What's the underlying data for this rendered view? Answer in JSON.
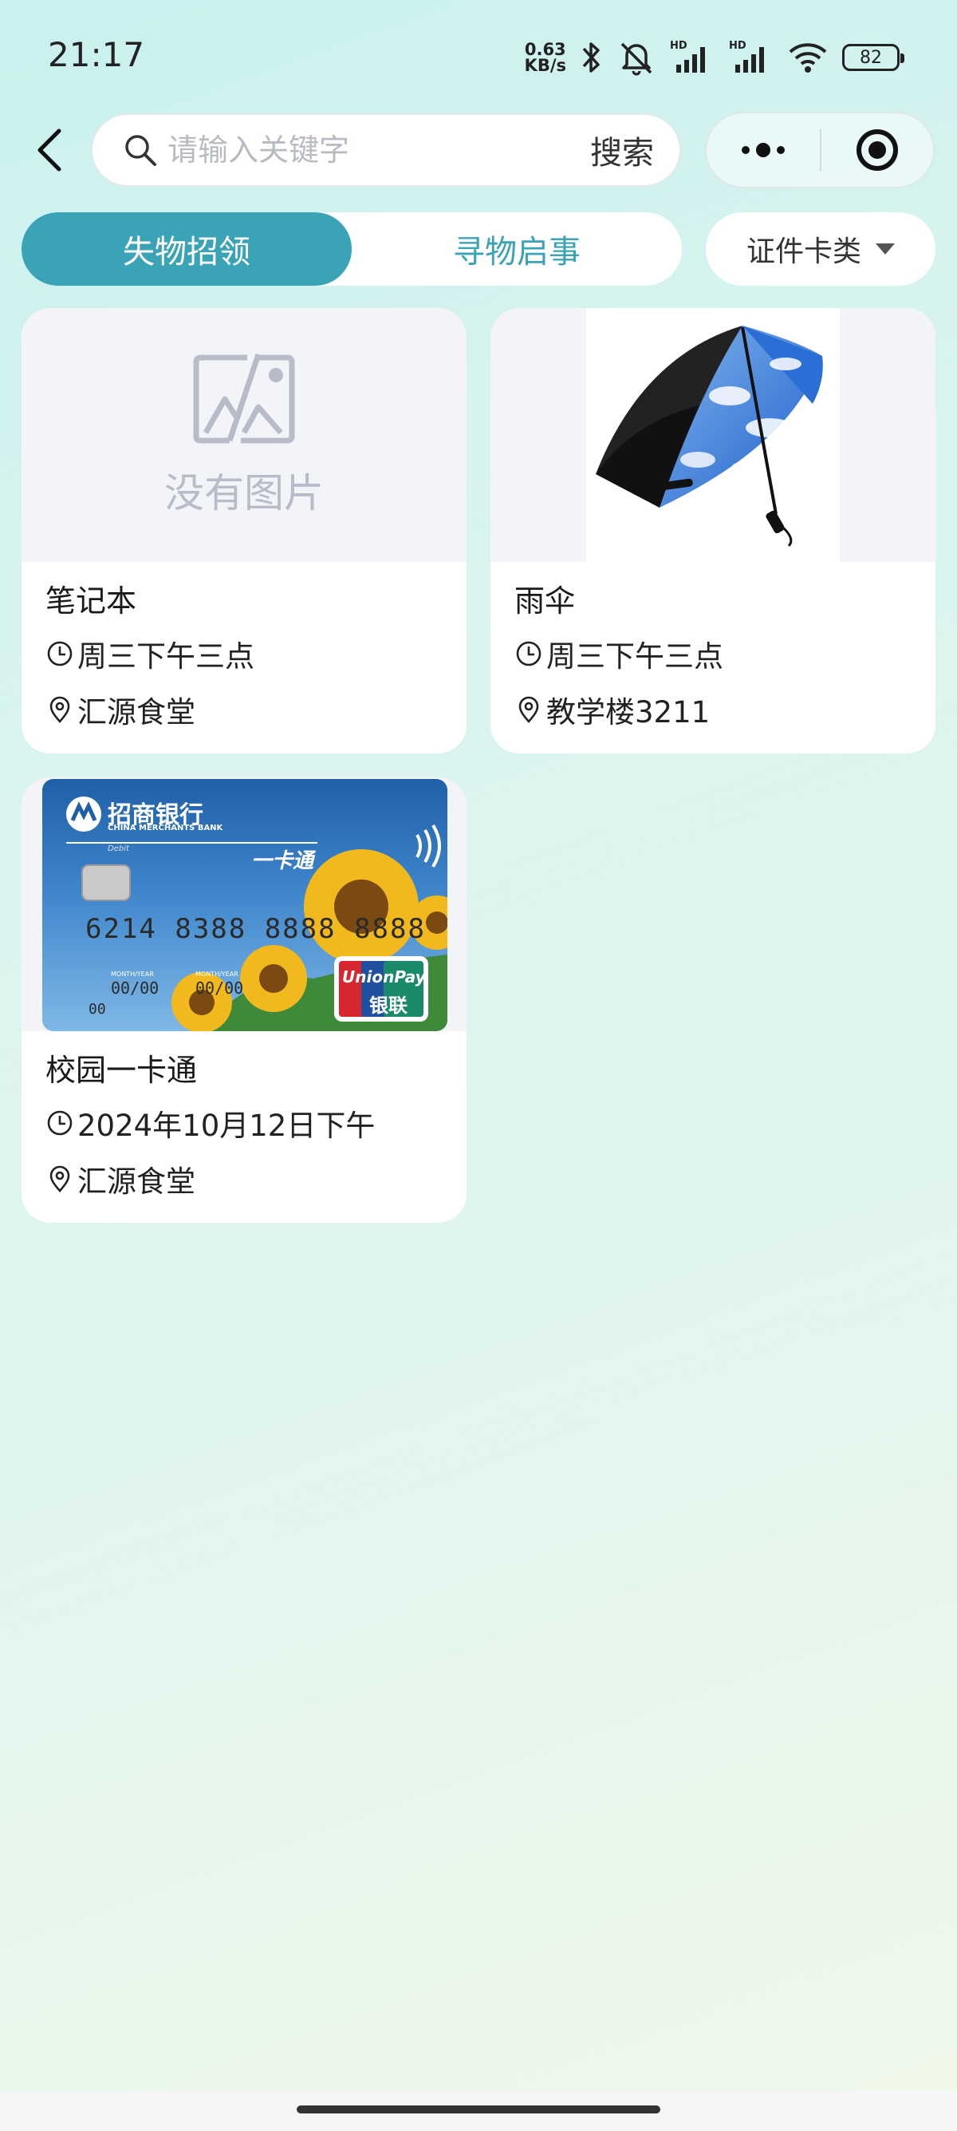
{
  "status_bar": {
    "time": "21:17",
    "net_speed_value": "0.63",
    "net_speed_unit": "KB/s",
    "battery": "82"
  },
  "search": {
    "placeholder": "请输入关键字",
    "button_label": "搜索"
  },
  "tabs": [
    {
      "label": "失物招领",
      "active": true
    },
    {
      "label": "寻物启事",
      "active": false
    }
  ],
  "category": {
    "selected": "证件卡类"
  },
  "items": [
    {
      "title": "笔记本",
      "time": "周三下午三点",
      "location": "汇源食堂",
      "image": "none",
      "no_image_text": "没有图片"
    },
    {
      "title": "雨伞",
      "time": "周三下午三点",
      "location": "教学楼3211",
      "image": "umbrella"
    },
    {
      "title": "校园一卡通",
      "time": "2024年10月12日下午",
      "location": "汇源食堂",
      "image": "bank-card",
      "card": {
        "bank_name": "招商银行",
        "bank_name_en": "CHINA MERCHANTS BANK",
        "debit": "Debit",
        "card_title": "一卡通",
        "card_number": "6214 8388 8888 8888",
        "valid_label_1": "MONTH/YEAR",
        "valid_label_2": "MONTH/YEAR",
        "valid_1": "00/00",
        "valid_2": "00/00",
        "cvv": "00",
        "unionpay_en": "UnionPay",
        "unionpay_cn": "银联"
      }
    }
  ],
  "colors": {
    "accent": "#3ba3b6",
    "page_bg": "#dcf4ef"
  }
}
